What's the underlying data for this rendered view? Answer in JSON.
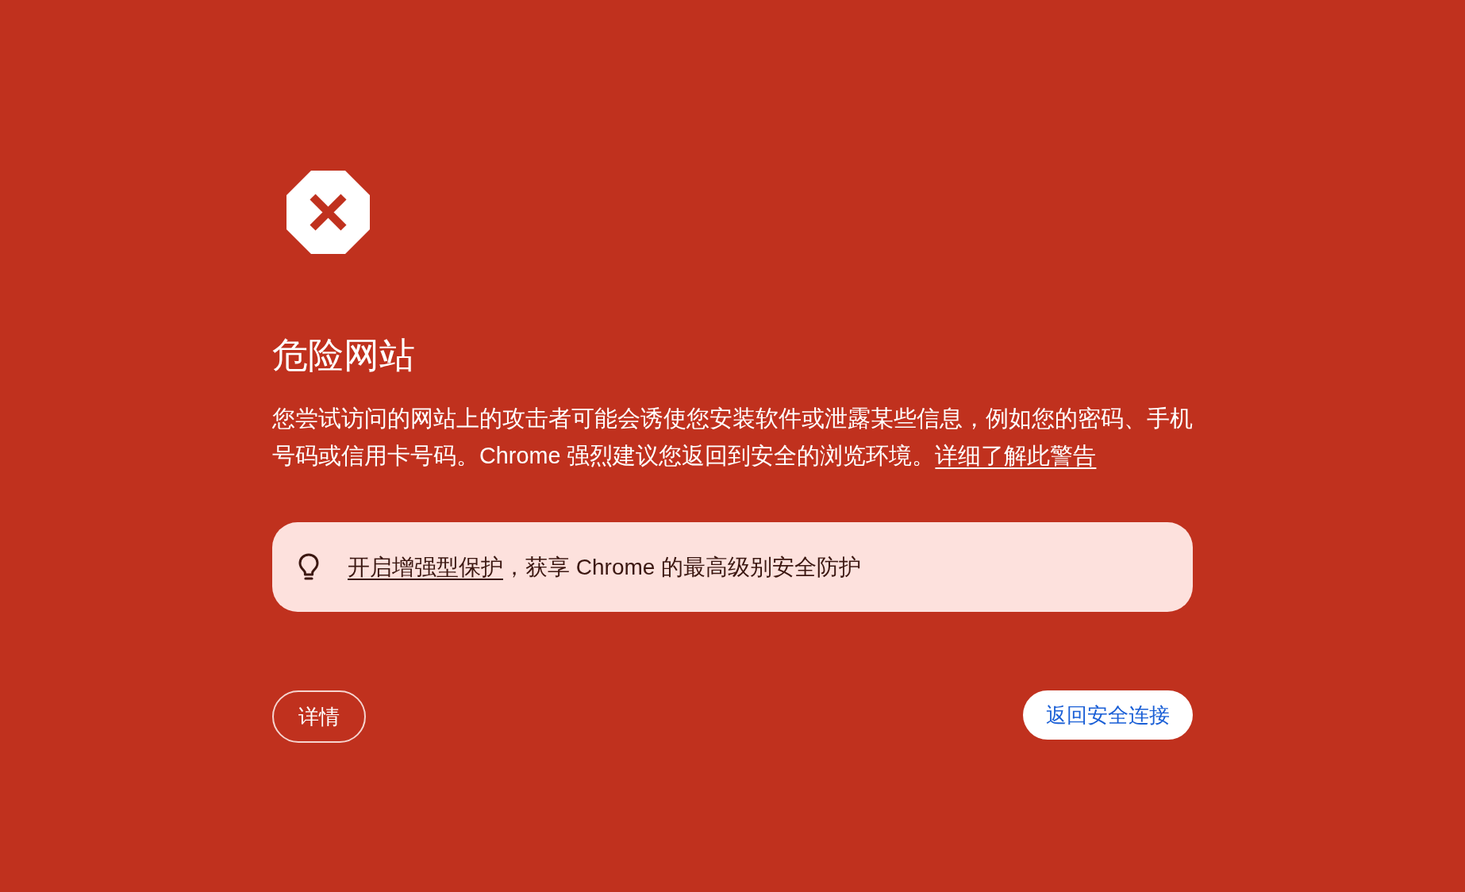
{
  "title": "危险网站",
  "message": {
    "text": "您尝试访问的网站上的攻击者可能会诱使您安装软件或泄露某些信息，例如您的密码、手机号码或信用卡号码。Chrome 强烈建议您返回到安全的浏览环境。",
    "link": "详细了解此警告"
  },
  "protection_tip": {
    "link": "开启增强型保护",
    "text": "，获享 Chrome 的最高级别安全防护"
  },
  "buttons": [
    {
      "label": "详情",
      "kind": "secondary"
    },
    {
      "label": "返回安全连接",
      "kind": "primary"
    }
  ]
}
